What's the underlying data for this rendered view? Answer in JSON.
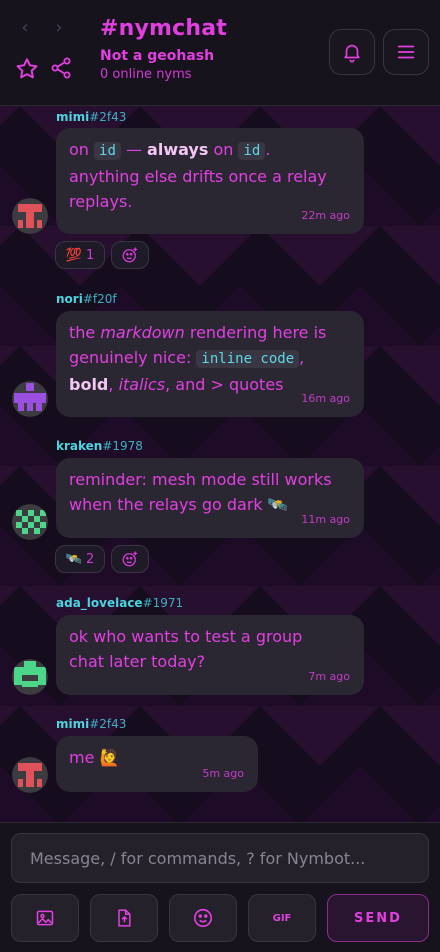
{
  "header": {
    "channel": "#nymchat",
    "subtitle": "Not a geohash",
    "online": "0 online nyms"
  },
  "messages": [
    {
      "nick": "mimi",
      "tag": "#2f43",
      "time": "22m ago",
      "parts": [
        "on ",
        "id",
        " — ",
        "always",
        " on ",
        "id",
        ".",
        "anything else drifts once a relay",
        "replays."
      ],
      "reactions": [
        {
          "emoji": "💯",
          "count": "1"
        }
      ]
    },
    {
      "nick": "nori",
      "tag": "#f20f",
      "time": "16m ago",
      "parts": [
        "the ",
        "markdown",
        " rendering here is",
        "genuinely nice: ",
        "inline code",
        ",",
        "bold",
        ", ",
        "italics",
        ", and > quotes"
      ]
    },
    {
      "nick": "kraken",
      "tag": "#1978",
      "time": "11m ago",
      "parts": [
        "reminder: mesh mode still works",
        "when the relays go dark 🛰️"
      ],
      "reactions": [
        {
          "emoji": "🛰️",
          "count": "2"
        }
      ]
    },
    {
      "nick": "ada_lovelace",
      "tag": "#1971",
      "time": "7m ago",
      "parts": [
        "ok who wants to test a group",
        "chat later today?"
      ]
    },
    {
      "nick": "mimi",
      "tag": "#2f43",
      "time": "5m ago",
      "parts": [
        "me 🙋"
      ]
    }
  ],
  "composer": {
    "placeholder": "Message, / for commands, ? for Nymbot...",
    "gif_label": "GIF",
    "send_label": "SEND"
  },
  "colors": {
    "accent": "#e23fe0",
    "nick": "#4bd5e0",
    "bubble": "#2a2733",
    "background": "#140f1c"
  }
}
